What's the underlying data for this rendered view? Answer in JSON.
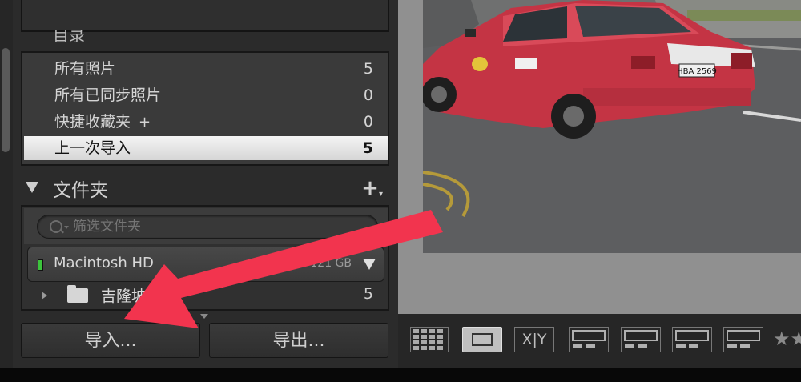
{
  "collections": {
    "cut_header": "目录",
    "items": [
      {
        "label": "所有照片",
        "count": "5"
      },
      {
        "label": "所有已同步照片",
        "count": "0"
      },
      {
        "label": "快捷收藏夹",
        "count": "0",
        "plus": "+"
      },
      {
        "label": "上一次导入",
        "count": "5",
        "selected": true
      }
    ]
  },
  "folders": {
    "title": "文件夹",
    "add_icon": "+",
    "search_placeholder": "筛选文件夹",
    "volume": {
      "name": "Macintosh HD",
      "size": "121 GB"
    },
    "folder": {
      "name": "吉隆坡",
      "count": "5"
    }
  },
  "buttons": {
    "import_label": "导入...",
    "export_label": "导出..."
  },
  "photo": {
    "plate": "HBA 2569"
  },
  "toolbar": {
    "icons": [
      "grid-view-icon",
      "loupe-view-icon",
      "compare-view-icon",
      "survey-view-icon",
      "people-view-icon",
      "map-view-icon",
      "book-view-icon",
      "rating-star-icon"
    ],
    "compare_label": "X|Y"
  },
  "colors": {
    "arrow": "#f2344e",
    "taxi": "#c93543",
    "selection": "#e8e8e8"
  }
}
